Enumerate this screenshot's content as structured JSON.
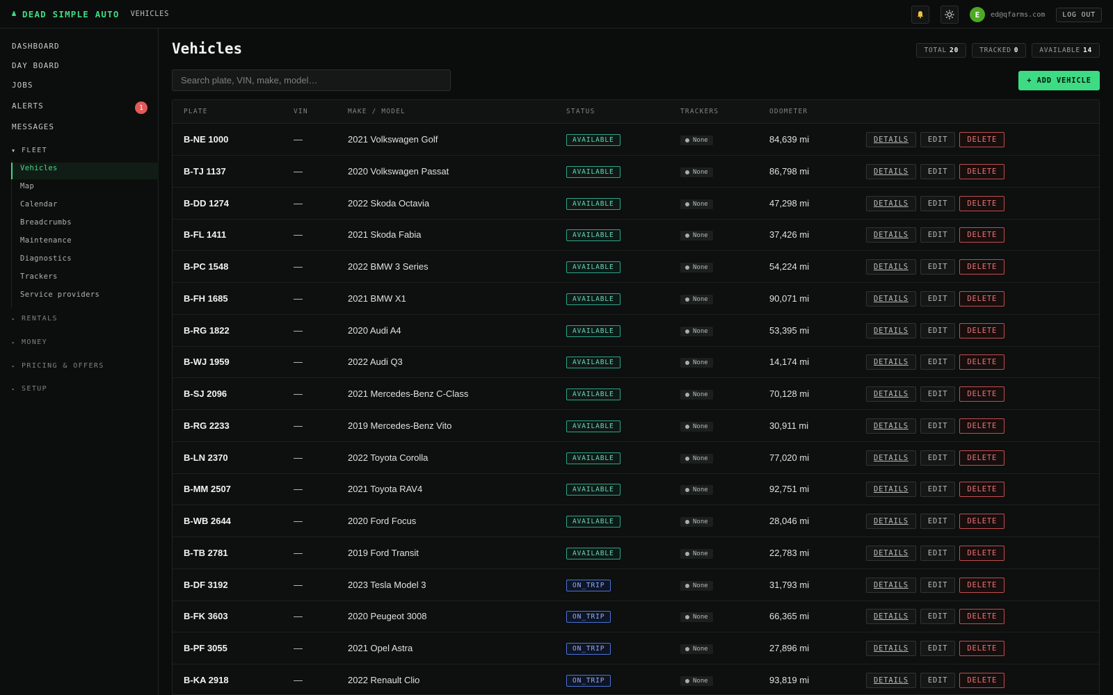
{
  "app": {
    "brand": "DEAD SIMPLE AUTO",
    "breadcrumb": "VEHICLES",
    "user_initial": "E",
    "user_email": "ed@qfarms.com",
    "logout_label": "LOG OUT"
  },
  "sidebar": {
    "top_items": [
      {
        "label": "DASHBOARD"
      },
      {
        "label": "DAY BOARD"
      },
      {
        "label": "JOBS"
      },
      {
        "label": "ALERTS",
        "badge": "1"
      },
      {
        "label": "MESSAGES"
      }
    ],
    "fleet": {
      "label": "FLEET",
      "items": [
        {
          "label": "Vehicles"
        },
        {
          "label": "Map"
        },
        {
          "label": "Calendar"
        },
        {
          "label": "Breadcrumbs"
        },
        {
          "label": "Maintenance"
        },
        {
          "label": "Diagnostics"
        },
        {
          "label": "Trackers"
        },
        {
          "label": "Service providers"
        }
      ]
    },
    "groups": [
      {
        "label": "RENTALS"
      },
      {
        "label": "MONEY"
      },
      {
        "label": "PRICING & OFFERS"
      },
      {
        "label": "SETUP"
      }
    ]
  },
  "main": {
    "title": "Vehicles",
    "stats": [
      {
        "label": "TOTAL",
        "value": "20"
      },
      {
        "label": "TRACKED",
        "value": "0"
      },
      {
        "label": "AVAILABLE",
        "value": "14"
      }
    ],
    "search_placeholder": "Search plate, VIN, make, model…",
    "add_label": "+ ADD VEHICLE"
  },
  "table": {
    "columns": [
      "PLATE",
      "VIN",
      "MAKE / MODEL",
      "STATUS",
      "TRACKERS",
      "ODOMETER"
    ],
    "action_labels": {
      "details": "DETAILS",
      "edit": "EDIT",
      "delete": "DELETE"
    },
    "rows": [
      {
        "plate": "B-NE 1000",
        "vin": "—",
        "model": "2021 Volkswagen Golf",
        "status": "AVAILABLE",
        "tracker": "None",
        "odometer": "84,639 mi"
      },
      {
        "plate": "B-TJ 1137",
        "vin": "—",
        "model": "2020 Volkswagen Passat",
        "status": "AVAILABLE",
        "tracker": "None",
        "odometer": "86,798 mi"
      },
      {
        "plate": "B-DD 1274",
        "vin": "—",
        "model": "2022 Skoda Octavia",
        "status": "AVAILABLE",
        "tracker": "None",
        "odometer": "47,298 mi"
      },
      {
        "plate": "B-FL 1411",
        "vin": "—",
        "model": "2021 Skoda Fabia",
        "status": "AVAILABLE",
        "tracker": "None",
        "odometer": "37,426 mi"
      },
      {
        "plate": "B-PC 1548",
        "vin": "—",
        "model": "2022 BMW 3 Series",
        "status": "AVAILABLE",
        "tracker": "None",
        "odometer": "54,224 mi"
      },
      {
        "plate": "B-FH 1685",
        "vin": "—",
        "model": "2021 BMW X1",
        "status": "AVAILABLE",
        "tracker": "None",
        "odometer": "90,071 mi"
      },
      {
        "plate": "B-RG 1822",
        "vin": "—",
        "model": "2020 Audi A4",
        "status": "AVAILABLE",
        "tracker": "None",
        "odometer": "53,395 mi"
      },
      {
        "plate": "B-WJ 1959",
        "vin": "—",
        "model": "2022 Audi Q3",
        "status": "AVAILABLE",
        "tracker": "None",
        "odometer": "14,174 mi"
      },
      {
        "plate": "B-SJ 2096",
        "vin": "—",
        "model": "2021 Mercedes-Benz C-Class",
        "status": "AVAILABLE",
        "tracker": "None",
        "odometer": "70,128 mi"
      },
      {
        "plate": "B-RG 2233",
        "vin": "—",
        "model": "2019 Mercedes-Benz Vito",
        "status": "AVAILABLE",
        "tracker": "None",
        "odometer": "30,911 mi"
      },
      {
        "plate": "B-LN 2370",
        "vin": "—",
        "model": "2022 Toyota Corolla",
        "status": "AVAILABLE",
        "tracker": "None",
        "odometer": "77,020 mi"
      },
      {
        "plate": "B-MM 2507",
        "vin": "—",
        "model": "2021 Toyota RAV4",
        "status": "AVAILABLE",
        "tracker": "None",
        "odometer": "92,751 mi"
      },
      {
        "plate": "B-WB 2644",
        "vin": "—",
        "model": "2020 Ford Focus",
        "status": "AVAILABLE",
        "tracker": "None",
        "odometer": "28,046 mi"
      },
      {
        "plate": "B-TB 2781",
        "vin": "—",
        "model": "2019 Ford Transit",
        "status": "AVAILABLE",
        "tracker": "None",
        "odometer": "22,783 mi"
      },
      {
        "plate": "B-DF 3192",
        "vin": "—",
        "model": "2023 Tesla Model 3",
        "status": "ON_TRIP",
        "tracker": "None",
        "odometer": "31,793 mi"
      },
      {
        "plate": "B-FK 3603",
        "vin": "—",
        "model": "2020 Peugeot 3008",
        "status": "ON_TRIP",
        "tracker": "None",
        "odometer": "66,365 mi"
      },
      {
        "plate": "B-PF 3055",
        "vin": "—",
        "model": "2021 Opel Astra",
        "status": "ON_TRIP",
        "tracker": "None",
        "odometer": "27,896 mi"
      },
      {
        "plate": "B-KA 2918",
        "vin": "—",
        "model": "2022 Renault Clio",
        "status": "ON_TRIP",
        "tracker": "None",
        "odometer": "93,819 mi"
      }
    ]
  },
  "colors": {
    "accent": "#3ddc84",
    "available": "#6fd6bb",
    "on_trip": "#8fb0ff",
    "danger": "#f07373",
    "alert_badge": "#e05a5a"
  }
}
